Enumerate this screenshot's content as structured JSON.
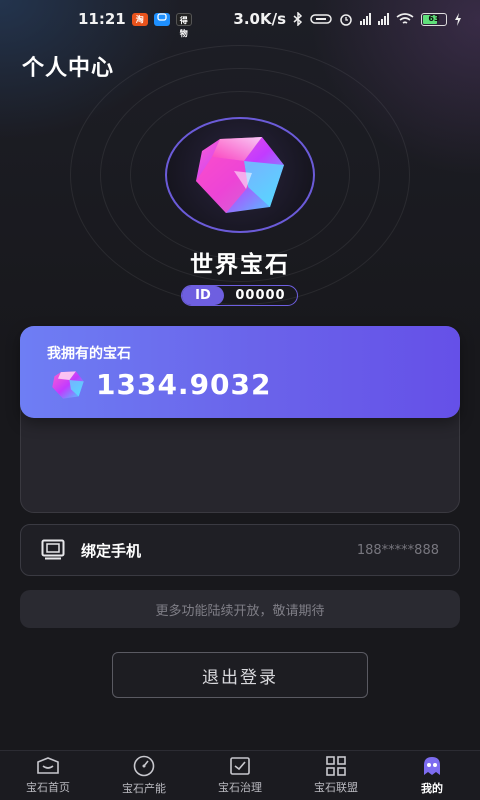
{
  "status_bar": {
    "time": "11:21",
    "network_speed": "3.0K/s",
    "battery": "63",
    "app_icons": [
      "淘",
      "",
      "得物"
    ],
    "signal_tags": [
      "HD",
      "HD"
    ]
  },
  "header": {
    "title": "个人中心"
  },
  "profile": {
    "name": "世界宝石",
    "id_label": "ID",
    "id_value": "00000",
    "avatar_icon": "gem-icon"
  },
  "gem_card": {
    "label": "我拥有的宝石",
    "amount": "1334.9032",
    "icon": "gem-icon"
  },
  "bind_phone": {
    "label": "绑定手机",
    "value": "188*****888",
    "icon": "phone-icon"
  },
  "notice": {
    "text": "更多功能陆续开放，敬请期待"
  },
  "logout": {
    "label": "退出登录"
  },
  "tabbar": {
    "active_index": 4,
    "items": [
      {
        "label": "宝石首页",
        "icon": "home-icon"
      },
      {
        "label": "宝石产能",
        "icon": "gauge-icon"
      },
      {
        "label": "宝石治理",
        "icon": "check-icon"
      },
      {
        "label": "宝石联盟",
        "icon": "grid-icon"
      },
      {
        "label": "我的",
        "icon": "robot-icon"
      }
    ]
  },
  "colors": {
    "accent": "#6e5fe0",
    "card_gradient_start": "#6e7ef4",
    "card_gradient_end": "#6550e8",
    "background": "#18181c"
  }
}
